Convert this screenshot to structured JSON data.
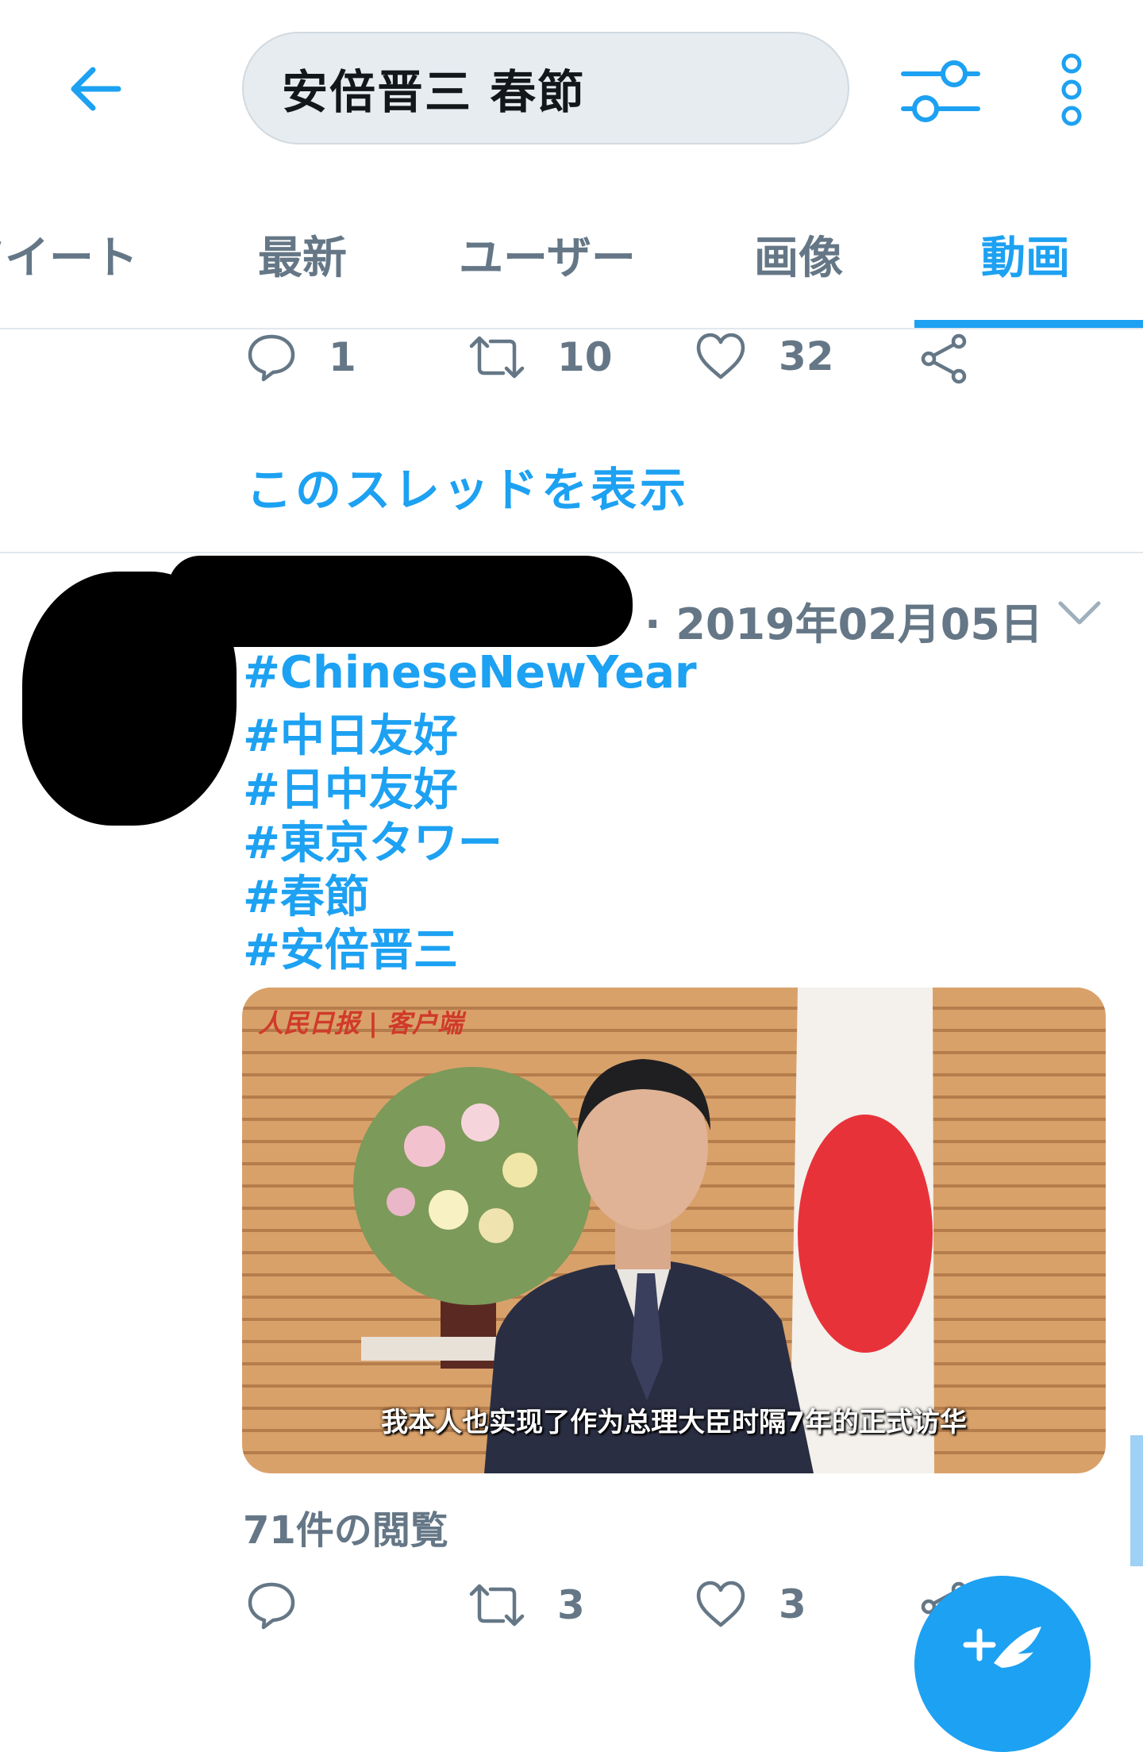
{
  "search": {
    "query": "安倍晋三 春節"
  },
  "tabs": [
    {
      "label": "ツイート"
    },
    {
      "label": "最新"
    },
    {
      "label": "ユーザー"
    },
    {
      "label": "画像"
    },
    {
      "label": "動画",
      "active": true
    }
  ],
  "prev_tweet": {
    "replies": "1",
    "retweets": "10",
    "likes": "32",
    "show_thread": "このスレッドを表示"
  },
  "tweet": {
    "date": "· 2019年02月05日",
    "hashtags": [
      "#ChineseNewYear",
      "#中日友好",
      "#日中友好",
      "#東京タワー",
      "#春節",
      "#安倍晋三"
    ],
    "video": {
      "watermark": "人民日报 | 客户端",
      "subtitle": "我本人也实现了作为总理大臣时隔7年的正式访华"
    },
    "views": "71件の閲覧",
    "replies": "",
    "retweets": "3",
    "likes": "3"
  },
  "colors": {
    "accent": "#1da1f2",
    "secondary_text": "#657786",
    "divider": "#e1e8ed",
    "search_bg": "#e6ecf0"
  },
  "icons": [
    "back-arrow-icon",
    "filter-icon",
    "more-vertical-icon",
    "reply-icon",
    "retweet-icon",
    "like-icon",
    "share-icon",
    "chevron-down-icon",
    "compose-icon"
  ]
}
